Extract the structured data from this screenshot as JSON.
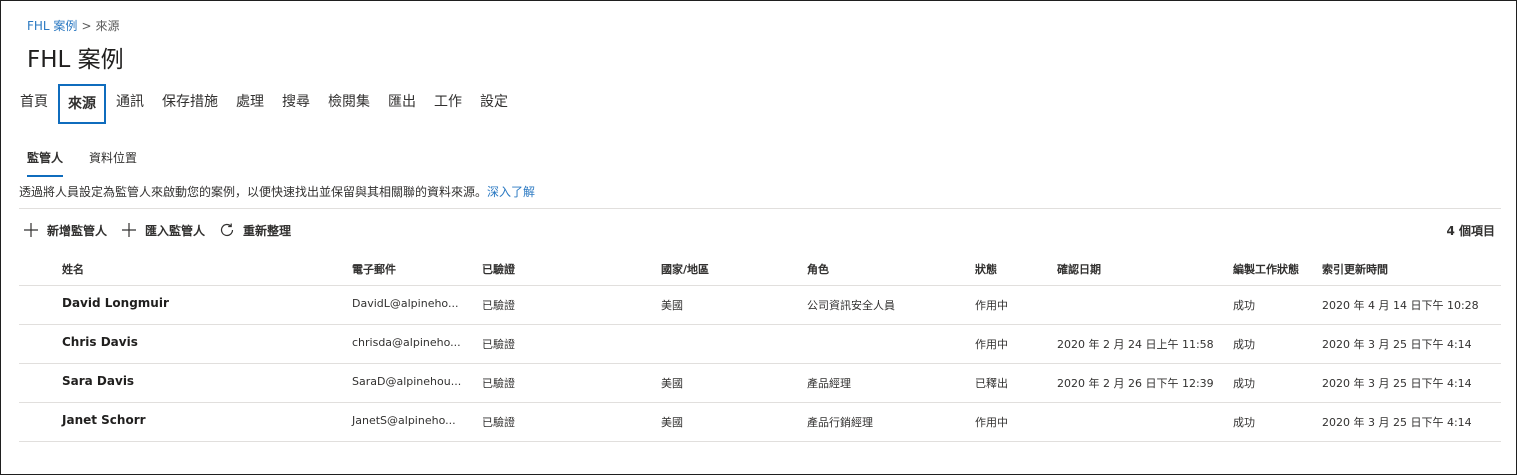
{
  "breadcrumb": {
    "parent": "FHL 案例",
    "separator": ">",
    "current": "來源"
  },
  "page_title": "FHL 案例",
  "tabs": [
    {
      "label": "首頁"
    },
    {
      "label": "來源",
      "active": true
    },
    {
      "label": "通訊"
    },
    {
      "label": "保存措施"
    },
    {
      "label": "處理"
    },
    {
      "label": "搜尋"
    },
    {
      "label": "檢閱集"
    },
    {
      "label": "匯出"
    },
    {
      "label": "工作"
    },
    {
      "label": "設定"
    }
  ],
  "subtabs": [
    {
      "label": "監管人",
      "active": true
    },
    {
      "label": "資料位置"
    }
  ],
  "description": {
    "text": "透過將人員設定為監管人來啟動您的案例，以便快速找出並保留與其相關聯的資料來源。",
    "link": "深入了解"
  },
  "commands": {
    "add": "新增監管人",
    "import": "匯入監管人",
    "refresh": "重新整理"
  },
  "item_count": "4 個項目",
  "table": {
    "columns": [
      "姓名",
      "電子郵件",
      "已驗證",
      "國家/地區",
      "角色",
      "狀態",
      "確認日期",
      "編製工作狀態",
      "索引更新時間"
    ],
    "rows": [
      [
        "David Longmuir",
        "DavidL@alpineho...",
        "已驗證",
        "美國",
        "公司資訊安全人員",
        "作用中",
        "",
        "成功",
        "2020 年 4 月 14 日下午 10:28"
      ],
      [
        "Chris Davis",
        "chrisda@alpineho...",
        "已驗證",
        "",
        "",
        "作用中",
        "2020 年 2 月 24 日上午 11:58",
        "成功",
        "2020 年 3 月 25 日下午 4:14"
      ],
      [
        "Sara Davis",
        "SaraD@alpinehou...",
        "已驗證",
        "美國",
        "產品經理",
        "已釋出",
        "2020 年 2 月 26 日下午 12:39",
        "成功",
        "2020 年 3 月 25 日下午 4:14"
      ],
      [
        "Janet Schorr",
        "JanetS@alpineho...",
        "已驗證",
        "美國",
        "產品行銷經理",
        "作用中",
        "",
        "成功",
        "2020 年 3 月 25 日下午 4:14"
      ]
    ]
  },
  "colors": {
    "accent": "#0f6cbd",
    "link": "#2b79c2",
    "text": "#323130",
    "divider": "#e1dfdd"
  },
  "icons": {
    "add": "plus-icon",
    "import": "plus-icon",
    "refresh": "refresh-icon"
  }
}
